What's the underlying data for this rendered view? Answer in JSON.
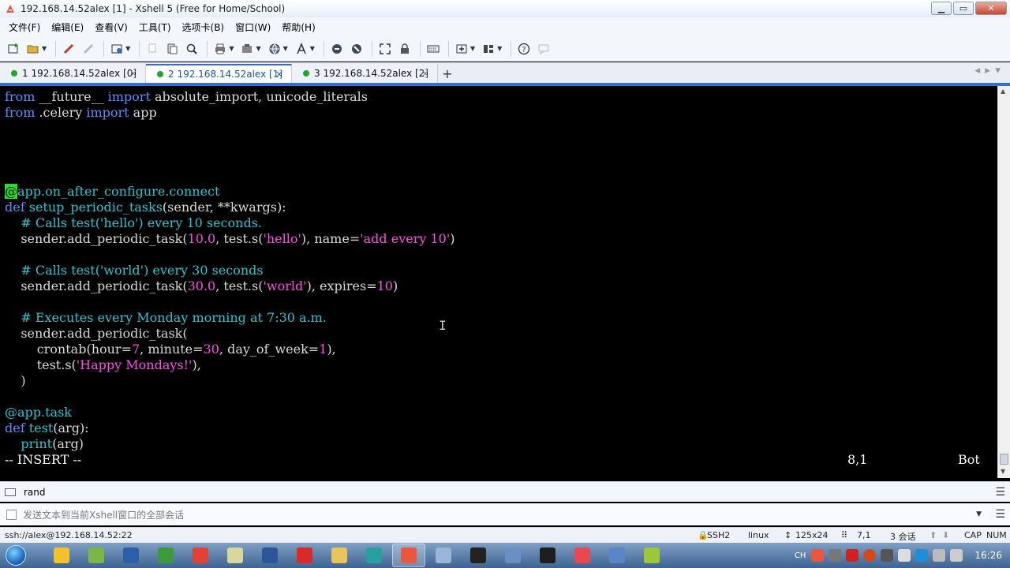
{
  "window": {
    "title": "192.168.14.52alex [1] - Xshell 5 (Free for Home/School)",
    "controls": {
      "minimize": "▁",
      "maximize": "▭",
      "close": "✕"
    }
  },
  "menu": [
    "文件(F)",
    "编辑(E)",
    "查看(V)",
    "工具(T)",
    "选项卡(B)",
    "窗口(W)",
    "帮助(H)"
  ],
  "toolbar_icons": [
    "new-session-icon",
    "open-folder-icon",
    "reconnect-icon",
    "disconnect-icon",
    "properties-icon",
    "copy-icon",
    "paste-icon",
    "find-icon",
    "print-icon",
    "transfer-icon",
    "globe-icon",
    "font-icon",
    "script-icon",
    "stop-icon",
    "fullscreen-icon",
    "lock-icon",
    "keyboard-icon",
    "new-tab-icon",
    "layout-icon",
    "help-icon",
    "chat-icon"
  ],
  "tabs": [
    {
      "label": "1 192.168.14.52alex [0]",
      "active": false
    },
    {
      "label": "2 192.168.14.52alex [1]",
      "active": true
    },
    {
      "label": "3 192.168.14.52alex [2]",
      "active": false
    }
  ],
  "tab_add": "+",
  "terminal": {
    "lines": {
      "l1_from": "from",
      "l1_mid": " __future__ ",
      "l1_import": "import",
      "l1_rest": " absolute_import, unicode_literals",
      "l2_from": "from",
      "l2_mid": " .celery ",
      "l2_import": "import",
      "l2_rest": " app",
      "l6_at": "@",
      "l6_rest": "app.on_after_configure.connect",
      "l7_def": "def",
      "l7_fn": " setup_periodic_tasks",
      "l7_rest": "(sender, **kwargs):",
      "l8_comment": "    # Calls test('hello') every 10 seconds.",
      "l9_a": "    sender.add_periodic_task(",
      "l9_num": "10.0",
      "l9_b": ", test.s(",
      "l9_str": "'hello'",
      "l9_c": "), name=",
      "l9_str2": "'add every 10'",
      "l9_d": ")",
      "l11_comment": "    # Calls test('world') every 30 seconds",
      "l12_a": "    sender.add_periodic_task(",
      "l12_num": "30.0",
      "l12_b": ", test.s(",
      "l12_str": "'world'",
      "l12_c": "), expires=",
      "l12_num2": "10",
      "l12_d": ")",
      "l14_comment": "    # Executes every Monday morning at 7:30 a.m.",
      "l15": "    sender.add_periodic_task(",
      "l16_a": "        crontab(hour=",
      "l16_n1": "7",
      "l16_b": ", minute=",
      "l16_n2": "30",
      "l16_c": ", day_of_week=",
      "l16_n3": "1",
      "l16_d": "),",
      "l17_a": "        test.s(",
      "l17_str": "'Happy Mondays!'",
      "l17_b": "),",
      "l18": "    )",
      "l20_deco": "@app.task",
      "l21_def": "def",
      "l21_fn": " test",
      "l21_rest": "(arg):",
      "l22_a": "    ",
      "l22_fn": "print",
      "l22_b": "(arg)"
    },
    "mode": "-- INSERT --",
    "position": "8,1",
    "scroll": "Bot"
  },
  "compose": {
    "label": "rand"
  },
  "send": {
    "placeholder": "发送文本到当前Xshell窗口的全部会话"
  },
  "status": {
    "connection": "ssh://alex@192.168.14.52:22",
    "protocol": "SSH2",
    "term": "linux",
    "size": "125x24",
    "cursor": "7,1",
    "sessions": "3 会话",
    "cap": "CAP",
    "num": "NUM"
  },
  "taskbar": {
    "lang": "CH",
    "clock": "16:26",
    "apps": [
      {
        "name": "taskbar-app-1",
        "color": "#f3c12c"
      },
      {
        "name": "taskbar-app-2",
        "color": "#7ab648"
      },
      {
        "name": "taskbar-app-3",
        "color": "#2b5fa8"
      },
      {
        "name": "taskbar-app-4",
        "color": "#3c9a3c"
      },
      {
        "name": "taskbar-app-chrome",
        "color": "#e34133"
      },
      {
        "name": "taskbar-app-6",
        "color": "#d7d7a0"
      },
      {
        "name": "taskbar-app-word",
        "color": "#2b579a"
      },
      {
        "name": "taskbar-app-8",
        "color": "#d92a2a"
      },
      {
        "name": "taskbar-app-explorer",
        "color": "#e8c45a"
      },
      {
        "name": "taskbar-app-10",
        "color": "#28a0a0"
      },
      {
        "name": "taskbar-app-xshell",
        "color": "#e9573f"
      },
      {
        "name": "taskbar-app-12",
        "color": "#9ab5d6"
      },
      {
        "name": "taskbar-app-cmd",
        "color": "#222222"
      },
      {
        "name": "taskbar-app-14",
        "color": "#6a8fc4"
      },
      {
        "name": "taskbar-app-pycharm",
        "color": "#1e1e1e"
      },
      {
        "name": "taskbar-app-16",
        "color": "#e8484f"
      },
      {
        "name": "taskbar-app-17",
        "color": "#5a86c8"
      },
      {
        "name": "taskbar-app-18",
        "color": "#9dc63b"
      }
    ]
  }
}
